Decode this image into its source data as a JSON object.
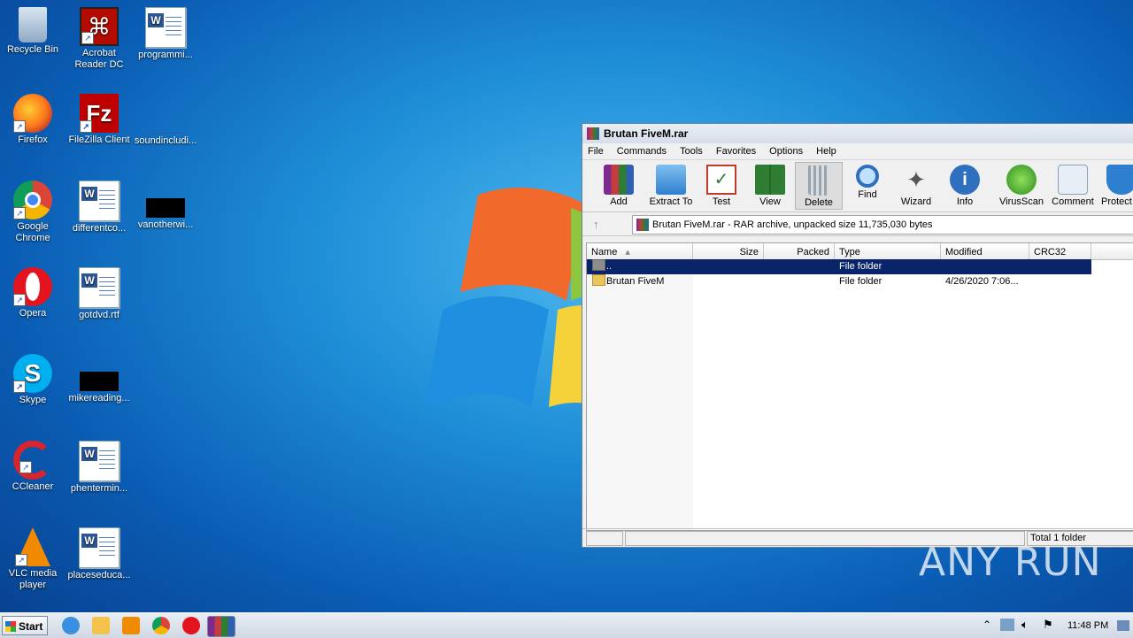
{
  "desktop": {
    "icons": [
      {
        "label": "Recycle Bin"
      },
      {
        "label": "Acrobat Reader DC"
      },
      {
        "label": "programmi..."
      },
      {
        "label": "Firefox"
      },
      {
        "label": "FileZilla Client"
      },
      {
        "label": "soundincludi..."
      },
      {
        "label": "Google Chrome"
      },
      {
        "label": "differentco..."
      },
      {
        "label": "vanotherwi..."
      },
      {
        "label": "Opera"
      },
      {
        "label": "gotdvd.rtf"
      },
      {
        "label": "Skype"
      },
      {
        "label": "mikereading..."
      },
      {
        "label": "CCleaner"
      },
      {
        "label": "phentermin..."
      },
      {
        "label": "VLC media player"
      },
      {
        "label": "placeseduca..."
      }
    ]
  },
  "window": {
    "title": "Brutan FiveM.rar",
    "menu": [
      "File",
      "Commands",
      "Tools",
      "Favorites",
      "Options",
      "Help"
    ],
    "toolbar": [
      "Add",
      "Extract To",
      "Test",
      "View",
      "Delete",
      "Find",
      "Wizard",
      "Info",
      "VirusScan",
      "Comment",
      "Protect"
    ],
    "address": "Brutan FiveM.rar - RAR archive, unpacked size 11,735,030 bytes",
    "columns": [
      "Name",
      "Size",
      "Packed",
      "Type",
      "Modified",
      "CRC32"
    ],
    "rows": [
      {
        "name": "..",
        "size": "",
        "packed": "",
        "type": "File folder",
        "modified": "",
        "crc": ""
      },
      {
        "name": "Brutan FiveM",
        "size": "",
        "packed": "",
        "type": "File folder",
        "modified": "4/26/2020 7:06...",
        "crc": ""
      }
    ],
    "status_right": "Total 1 folder"
  },
  "taskbar": {
    "start_label": "Start",
    "clock": "11:48 PM"
  },
  "watermark": "ANY RUN"
}
